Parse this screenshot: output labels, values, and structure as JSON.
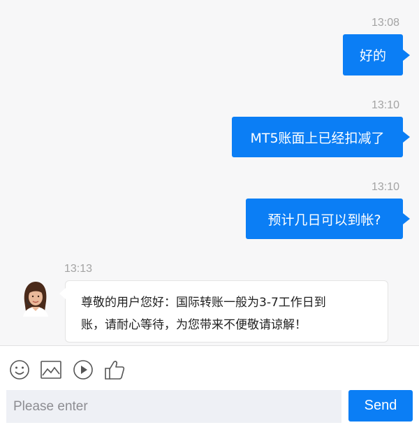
{
  "messages": [
    {
      "time": "13:08",
      "text": "好的",
      "from": "user"
    },
    {
      "time": "13:10",
      "text": "MT5账面上已经扣减了",
      "from": "user"
    },
    {
      "time": "13:10",
      "text": "预计几日可以到帐?",
      "from": "user"
    },
    {
      "time": "13:13",
      "line1": "尊敬的用户您好：国际转账一般为3-7工作日到",
      "line2": "账，请耐心等待，为您带来不便敬请谅解！",
      "from": "agent"
    }
  ],
  "toolbar": {
    "icons": [
      "emoji-icon",
      "image-icon",
      "video-icon",
      "thumbs-up-icon"
    ]
  },
  "composer": {
    "placeholder": "Please enter",
    "send_label": "Send"
  },
  "colors": {
    "accent": "#0b7ef5",
    "background": "#f7f7f8",
    "timestamp": "#a3a3a3"
  }
}
